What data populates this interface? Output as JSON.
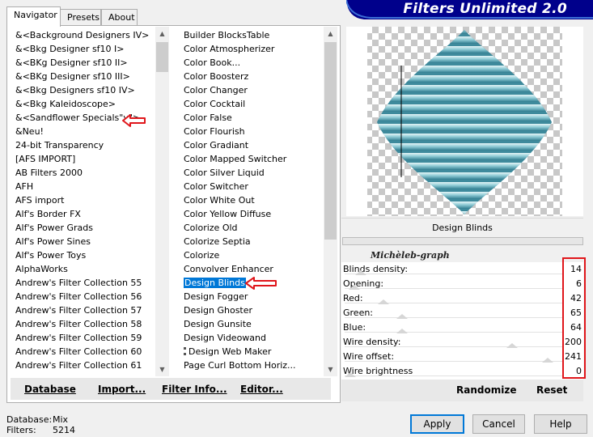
{
  "tabs": [
    {
      "label": "Navigator",
      "active": true
    },
    {
      "label": "Presets",
      "active": false
    },
    {
      "label": "About",
      "active": false
    }
  ],
  "banner_title": "Filters Unlimited 2.0",
  "categories": [
    "&<Background Designers IV>",
    "&<Bkg Designer sf10 I>",
    "&<BKg Designer sf10 II>",
    "&<BKg Designer sf10 III>",
    "&<Bkg Designers sf10 IV>",
    "&<Bkg Kaleidoscope>",
    "&<Sandflower Specials\"v\">",
    "&Neu!",
    "24-bit Transparency",
    "[AFS IMPORT]",
    "AB Filters 2000",
    "AFH",
    "AFS import",
    "Alf's Border FX",
    "Alf's Power Grads",
    "Alf's Power Sines",
    "Alf's Power Toys",
    "AlphaWorks",
    "Andrew's Filter Collection 55",
    "Andrew's Filter Collection 56",
    "Andrew's Filter Collection 57",
    "Andrew's Filter Collection 58",
    "Andrew's Filter Collection 59",
    "Andrew's Filter Collection 60",
    "Andrew's Filter Collection 61"
  ],
  "filters": [
    "Builder BlocksTable",
    "Color Atmospherizer",
    "Color Book...",
    "Color Boosterz",
    "Color Changer",
    "Color Cocktail",
    "Color False",
    "Color Flourish",
    "Color Gradiant",
    "Color Mapped Switcher",
    "Color Silver Liquid",
    "Color Switcher",
    "Color White Out",
    "Color Yellow Diffuse",
    "Colorize Old",
    "Colorize Septia",
    "Colorize",
    "Convolver Enhancer",
    "Design Blinds",
    "Design Fogger",
    "Design Ghoster",
    "Design Gunsite",
    "Design Videowand",
    "Design Web Maker",
    "Page Curl Bottom Horiz..."
  ],
  "selected_filter": "Design Blinds",
  "toolbar": {
    "database": "Database",
    "import": "Import...",
    "filter_info": "Filter Info...",
    "editor": "Editor..."
  },
  "filter_title": "Design Blinds",
  "author": "Michèleb-graph",
  "params": [
    {
      "label": "Blinds density:",
      "value": "14",
      "slider": 0.05
    },
    {
      "label": "Opening:",
      "value": "6",
      "slider": 0.02
    },
    {
      "label": "Red:",
      "value": "42",
      "slider": 0.16
    },
    {
      "label": "Green:",
      "value": "65",
      "slider": 0.25
    },
    {
      "label": "Blue:",
      "value": "64",
      "slider": 0.25
    },
    {
      "label": "Wire density:",
      "value": "200",
      "slider": 0.78
    },
    {
      "label": "Wire offset:",
      "value": "241",
      "slider": 0.95
    },
    {
      "label": "Wire brightness",
      "value": "0",
      "slider": 0.0
    }
  ],
  "preview_actions": {
    "randomize": "Randomize",
    "reset": "Reset"
  },
  "footer": {
    "database_label": "Database:",
    "database_value": "Mix",
    "filters_label": "Filters:",
    "filters_value": "5214"
  },
  "buttons": {
    "apply": "Apply",
    "cancel": "Cancel",
    "help": "Help"
  },
  "colors": {
    "banner": "#00008b",
    "selection": "#0078d7",
    "annotation": "#e0161b",
    "blinds_light": "#c6e6ec",
    "blinds_dark": "#3e8a9c"
  }
}
